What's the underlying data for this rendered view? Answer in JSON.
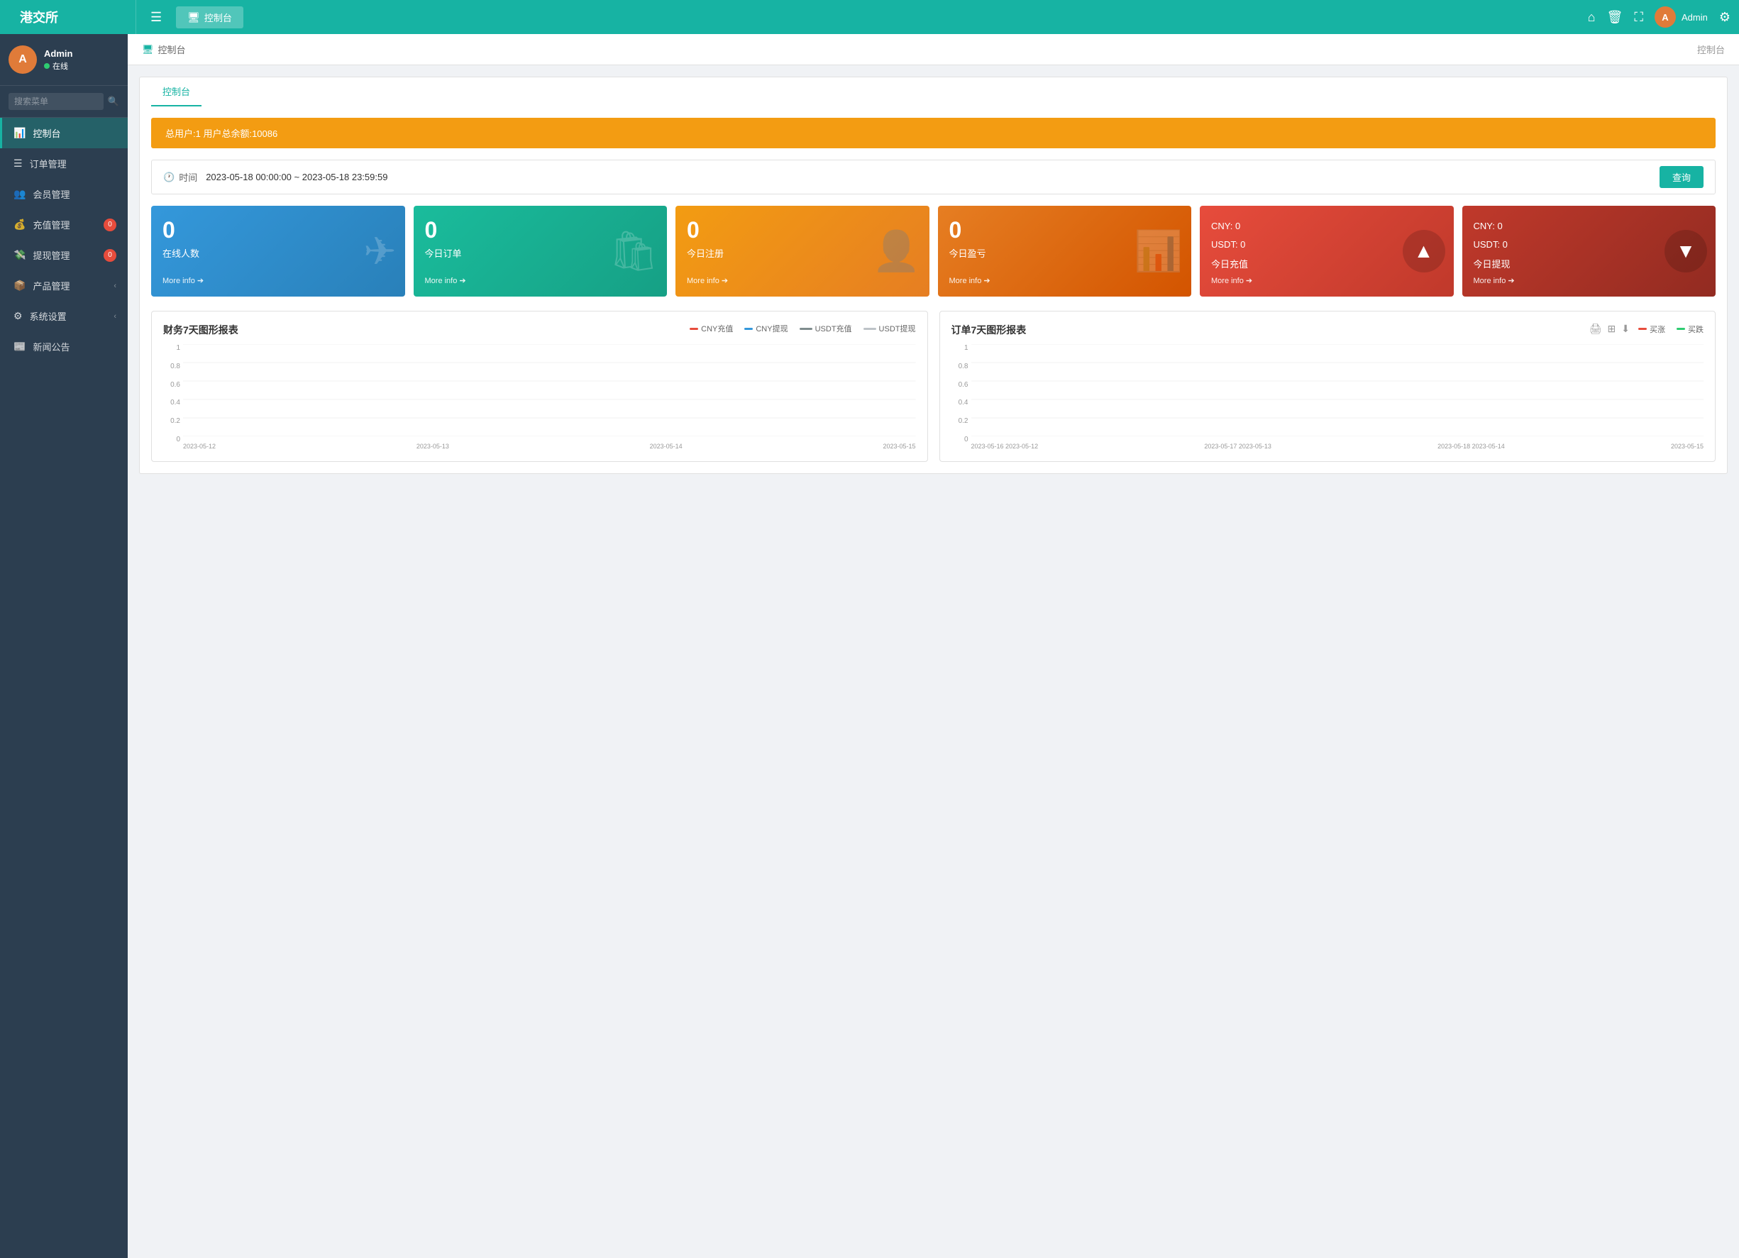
{
  "app": {
    "logo": "港交所",
    "nav_tab_icon": "🖥",
    "nav_tab_label": "控制台"
  },
  "header_icons": {
    "home": "⌂",
    "delete": "🗑",
    "fullscreen": "⛶",
    "settings": "⚙"
  },
  "user": {
    "name": "Admin",
    "status": "在线",
    "avatar_initial": "A"
  },
  "sidebar": {
    "search_placeholder": "搜索菜单",
    "items": [
      {
        "id": "dashboard",
        "label": "控制台",
        "icon": "📊",
        "active": true,
        "badge": null
      },
      {
        "id": "orders",
        "label": "订单管理",
        "icon": "📋",
        "active": false,
        "badge": null
      },
      {
        "id": "members",
        "label": "会员管理",
        "icon": "👥",
        "active": false,
        "badge": null
      },
      {
        "id": "deposit",
        "label": "充值管理",
        "icon": "💰",
        "active": false,
        "badge": "0"
      },
      {
        "id": "withdraw",
        "label": "提现管理",
        "icon": "💸",
        "active": false,
        "badge": "0"
      },
      {
        "id": "products",
        "label": "产品管理",
        "icon": "📦",
        "active": false,
        "badge": null,
        "arrow": "‹"
      },
      {
        "id": "system",
        "label": "系统设置",
        "icon": "⚙",
        "active": false,
        "badge": null,
        "arrow": "‹"
      },
      {
        "id": "news",
        "label": "新闻公告",
        "icon": "📰",
        "active": false,
        "badge": null
      }
    ]
  },
  "page": {
    "breadcrumb_icon": "🖥",
    "breadcrumb_label": "控制台",
    "breadcrumb_right": "控制台",
    "tab_label": "控制台"
  },
  "alert": {
    "text": "总用户:1  用户总余额:10086"
  },
  "filter": {
    "icon": "🕐",
    "label": "时间",
    "value": "2023-05-18 00:00:00 ~ 2023-05-18 23:59:59",
    "query_btn": "查询"
  },
  "stats": [
    {
      "id": "online",
      "value": "0",
      "label": "在线人数",
      "more": "More info ➔",
      "type": "blue",
      "bg_icon": "✈"
    },
    {
      "id": "orders",
      "value": "0",
      "label": "今日订单",
      "more": "More info ➔",
      "type": "teal",
      "bg_icon": "🛍"
    },
    {
      "id": "register",
      "value": "0",
      "label": "今日注册",
      "more": "More info ➔",
      "type": "orange",
      "bg_icon": "👤"
    },
    {
      "id": "profit",
      "value": "0",
      "label": "今日盈亏",
      "more": "More info ➔",
      "type": "orange2",
      "bg_icon": "📊"
    },
    {
      "id": "deposit",
      "cny_label": "CNY:",
      "cny_value": "0",
      "usdt_label": "USDT:",
      "usdt_value": "0",
      "label": "今日充值",
      "more": "More info ➔",
      "type": "red",
      "bg_icon": "▲",
      "arrow_color": "#c0392b"
    },
    {
      "id": "withdraw",
      "cny_label": "CNY:",
      "cny_value": "0",
      "usdt_label": "USDT:",
      "usdt_value": "0",
      "label": "今日提现",
      "more": "More info ➔",
      "type": "red2",
      "bg_icon": "▼",
      "arrow_color": "#922b21"
    }
  ],
  "finance_chart": {
    "title": "财务7天图形报表",
    "legend": [
      {
        "label": "CNY充值",
        "color": "#e74c3c"
      },
      {
        "label": "CNY提现",
        "color": "#3498db"
      },
      {
        "label": "USDT充值",
        "color": "#7f8c8d"
      },
      {
        "label": "USDT提现",
        "color": "#bdc3c7"
      }
    ],
    "x_labels": [
      "2023-05-12",
      "2023-05-13",
      "2023-05-14",
      "2023-05-15"
    ],
    "y_labels": [
      "1",
      "0.8",
      "0.6",
      "0.4",
      "0.2",
      "0"
    ]
  },
  "order_chart": {
    "title": "订单7天图形报表",
    "legend": [
      {
        "label": "买涨",
        "color": "#e74c3c"
      },
      {
        "label": "买跌",
        "color": "#2ecc71"
      }
    ],
    "x_labels": [
      "2023-05-16 2023-05-12",
      "2023-05-17 2023-05-13",
      "2023-05-18 2023-05-14",
      "2023-05-15"
    ],
    "y_labels": [
      "1",
      "0.8",
      "0.6",
      "0.4",
      "0.2",
      "0"
    ],
    "tools": [
      "🖨",
      "⊞",
      "⬇"
    ]
  }
}
